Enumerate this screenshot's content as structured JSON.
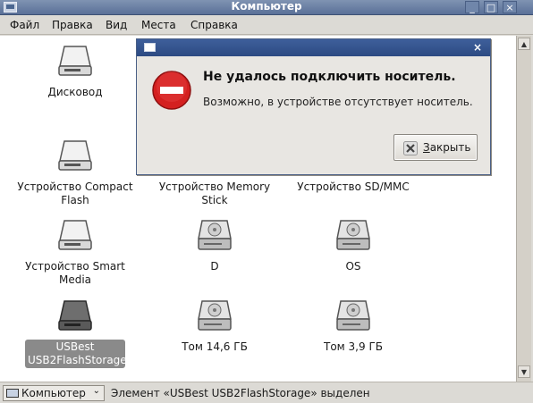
{
  "window": {
    "title": "Компьютер",
    "minimize_glyph": "_",
    "maximize_glyph": "□",
    "close_glyph": "×"
  },
  "menubar": {
    "items": [
      {
        "label": "Файл"
      },
      {
        "label": "Правка"
      },
      {
        "label": "Вид"
      },
      {
        "label": "Места"
      },
      {
        "label": "Справка"
      }
    ]
  },
  "content": {
    "items": [
      {
        "label": "Дисковод",
        "icon": "floppy-drive-icon"
      },
      {
        "label": "Устройство Compact Flash",
        "icon": "removable-drive-icon"
      },
      {
        "label": "Устройство Memory Stick",
        "icon": "removable-drive-icon"
      },
      {
        "label": "Устройство SD/MMC",
        "icon": "removable-drive-icon"
      },
      {
        "label": "Устройство Smart Media",
        "icon": "removable-drive-icon"
      },
      {
        "label": "D",
        "icon": "hard-drive-icon"
      },
      {
        "label": "OS",
        "icon": "hard-drive-icon"
      },
      {
        "label": "USBest USB2FlashStorage",
        "icon": "usb-drive-icon",
        "selected": true
      },
      {
        "label": "Том 14,6 ГБ",
        "icon": "hard-drive-icon"
      },
      {
        "label": "Том 3,9 ГБ",
        "icon": "hard-drive-icon"
      }
    ]
  },
  "statusbar": {
    "location": "Компьютер",
    "status": "Элемент «USBest USB2FlashStorage» выделен"
  },
  "dialog": {
    "heading": "Не удалось подключить носитель.",
    "message": "Возможно, в устройстве отсутствует носитель.",
    "close_button": "Закрыть",
    "close_glyph": "×"
  },
  "colors": {
    "titlebar": "#5a7098",
    "dialog_titlebar": "#2c4a82",
    "error_red": "#d42020",
    "selection": "#8a8a8a"
  }
}
